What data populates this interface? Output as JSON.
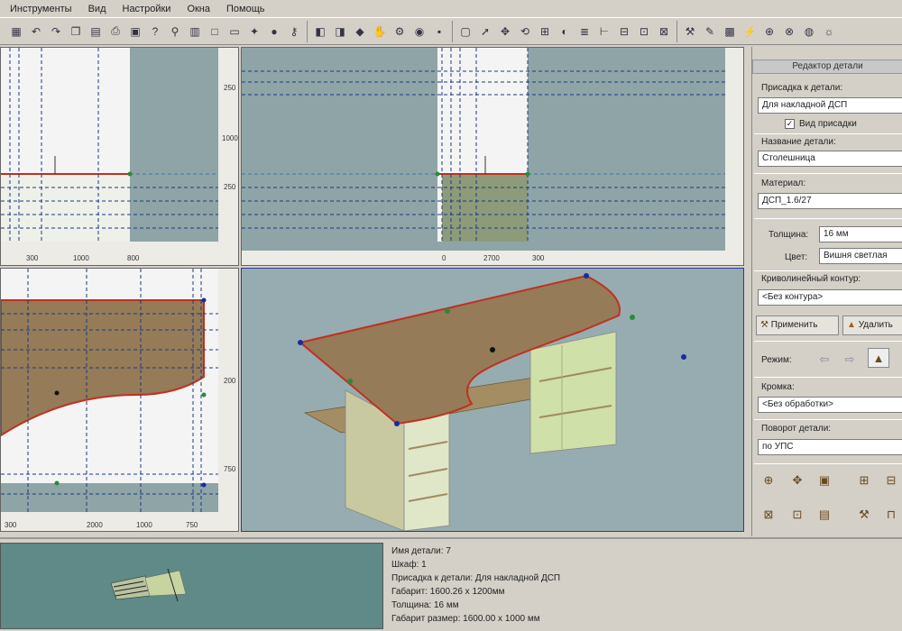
{
  "menu": [
    "Инструменты",
    "Вид",
    "Настройки",
    "Окна",
    "Помощь"
  ],
  "toolbar": {
    "group1": [
      "grid-icon",
      "undo-icon",
      "redo-icon",
      "copy-icon",
      "paste-icon",
      "print-icon",
      "print-preview-icon",
      "help-icon",
      "pin-icon",
      "chart-icon",
      "new-icon",
      "folder-icon",
      "star-icon",
      "dot-icon",
      "search-icon"
    ],
    "group2": [
      "panel-icon",
      "dimension-icon",
      "cube-icon",
      "hand-icon",
      "gear-icon",
      "eye-icon",
      "camera-icon"
    ],
    "group3": [
      "box-icon",
      "cursor-icon",
      "move-icon",
      "rotate-icon",
      "table-icon",
      "palette-icon",
      "layers-icon",
      "ruler-icon",
      "section-icon",
      "door-icon",
      "lock-icon"
    ],
    "group4": [
      "wrench-icon",
      "paint-icon",
      "material-icon",
      "bolt-icon",
      "drill-icon",
      "saw-icon",
      "sphere-icon",
      "settings-icon"
    ]
  },
  "views": {
    "top_left": {
      "labels_right": [
        "250",
        "1000",
        "250"
      ],
      "labels_bottom": [
        "300",
        "1000",
        "800"
      ]
    },
    "top_right": {
      "labels_bottom": [
        "0",
        "2700",
        "300"
      ]
    },
    "bottom_left": {
      "labels_right": [
        "200",
        "750"
      ],
      "labels_bottom": [
        "300",
        "2000",
        "1000",
        "750"
      ]
    }
  },
  "right_panel": {
    "title": "Редактор детали",
    "prisadka_label": "Присадка к детали:",
    "prisadka_value": "Для накладной ДСП",
    "checkbox_label": "Вид присадки",
    "name_label": "Название детали:",
    "name_value": "Столешница",
    "material_label": "Материал:",
    "material_value": "ДСП_1.6/27",
    "thickness_label": "Толщина:",
    "thickness_value": "16 мм",
    "color_label": "Цвет:",
    "color_value": "Вишня светлая",
    "contour_label": "Криволинейный контур:",
    "contour_value": "<Без контура>",
    "apply_label": "Применить",
    "delete_label": "Удалить",
    "mode_label": "Режим:",
    "edge_label": "Кромка:",
    "edge_value": "<Без обработки>",
    "rotate_label": "Поворот детали:",
    "rotate_value": "по УПС"
  },
  "status": {
    "lines": [
      "Имя детали: 7",
      "Шкаф: 1",
      "Присадка к детали: Для накладной ДСП",
      "Габарит: 1600.26 x 1200мм",
      "Толщина: 16 мм",
      "Габарит размер: 1600.00 x 1000 мм"
    ]
  }
}
